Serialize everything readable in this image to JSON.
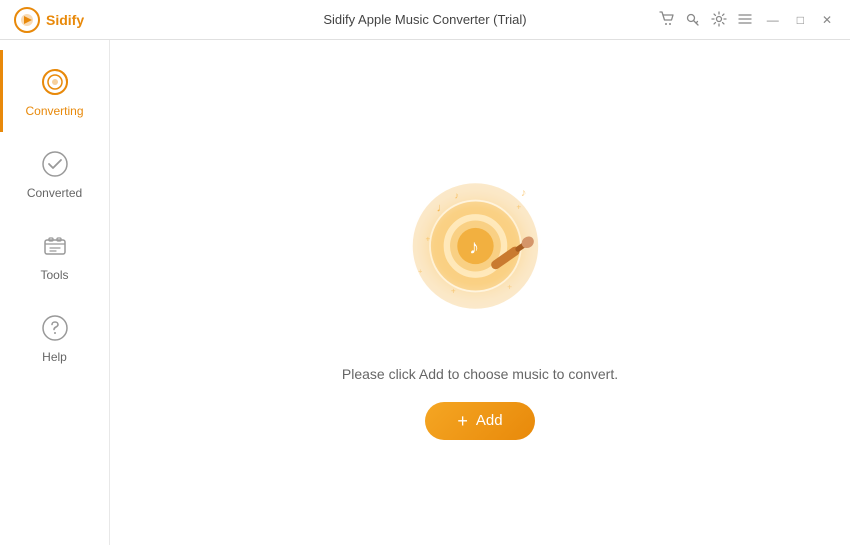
{
  "titlebar": {
    "logo_text": "Sidify",
    "title": "Sidify Apple Music Converter (Trial)"
  },
  "sidebar": {
    "items": [
      {
        "id": "converting",
        "label": "Converting",
        "active": true
      },
      {
        "id": "converted",
        "label": "Converted",
        "active": false
      },
      {
        "id": "tools",
        "label": "Tools",
        "active": false
      },
      {
        "id": "help",
        "label": "Help",
        "active": false
      }
    ]
  },
  "content": {
    "prompt_text": "Please click Add to choose music to convert.",
    "add_button_label": "Add"
  },
  "colors": {
    "accent": "#e8890a",
    "active_border": "#e8890a"
  }
}
